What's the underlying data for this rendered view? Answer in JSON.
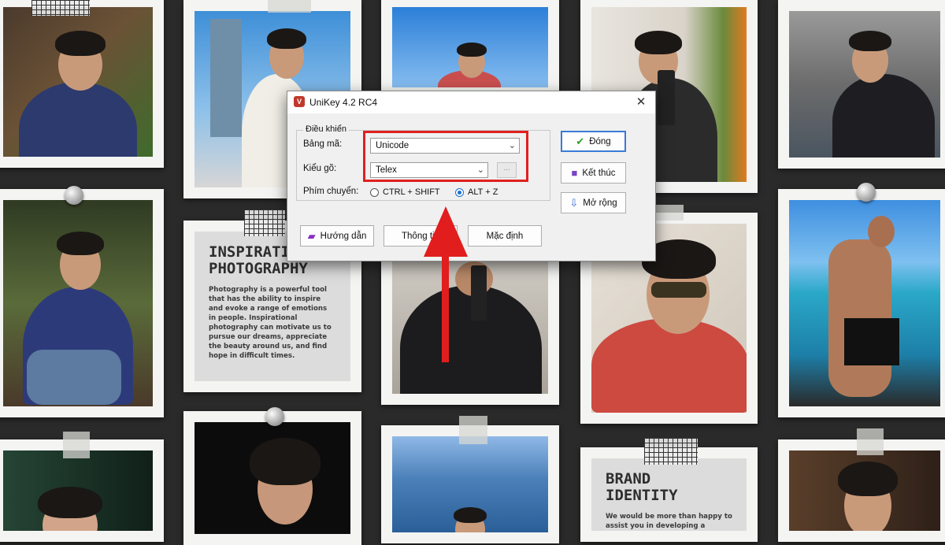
{
  "cards": {
    "inspirational": {
      "title": "INSPIRATIONAL\nPHOTOGRAPHY",
      "body": "Photography is a powerful tool that has the ability to inspire and evoke a range of emotions in people. Inspirational photography can motivate us to pursue our dreams, appreciate the beauty around us, and find hope in difficult times."
    },
    "brand": {
      "title": "BRAND\nIDENTITY",
      "body": "We would be more than happy to assist you in developing a"
    }
  },
  "dialog": {
    "title": "UniKey 4.2 RC4",
    "close": "✕",
    "group_label": "Điều khiển",
    "charset_label": "Bảng mã:",
    "charset_value": "Unicode",
    "input_label": "Kiểu gõ:",
    "input_value": "Telex",
    "dots": "...",
    "switch_label": "Phím chuyển:",
    "switch_options": [
      "CTRL + SHIFT",
      "ALT + Z"
    ],
    "buttons": {
      "close": "Đóng",
      "exit": "Kết thúc",
      "expand": "Mở rộng",
      "guide": "Hướng dẫn",
      "info": "Thông tin",
      "default": "Mặc định"
    }
  },
  "colors": {
    "highlight": "#e02020",
    "arrow": "#e11d1d",
    "wall": "#2a2a2a"
  }
}
